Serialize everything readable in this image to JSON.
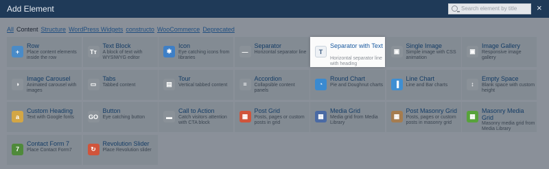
{
  "header": {
    "title": "Add Element",
    "search_placeholder": "Search element by title",
    "close_glyph": "×"
  },
  "tabs": [
    "All",
    "Content",
    "Structure",
    "WordPress Widgets",
    "constructo",
    "WooCommerce",
    "Deprecated"
  ],
  "tiles": [
    {
      "name": "Row",
      "desc": "Place content elements inside the row",
      "icon": "row-icon",
      "glyph": "+",
      "color": "#4a8bc7"
    },
    {
      "name": "Text Block",
      "desc": "A block of text with WYSIWYG editor",
      "icon": "text-block-icon",
      "glyph": "Tт",
      "color": "#8a9198"
    },
    {
      "name": "Icon",
      "desc": "Eye catching icons from libraries",
      "icon": "icon-element-icon",
      "glyph": "✱",
      "color": "#3e7fc6"
    },
    {
      "name": "Separator",
      "desc": "Horizontal separator line",
      "icon": "separator-icon",
      "glyph": "—",
      "color": "#8a9198"
    },
    {
      "name": "Separator with Text",
      "desc": "Horizontal separator line with heading",
      "icon": "separator-with-text-icon",
      "glyph": "T",
      "color": "#eef1f5"
    },
    {
      "name": "Single Image",
      "desc": "Simple image with CSS animation",
      "icon": "single-image-icon",
      "glyph": "▣",
      "color": "#8a9198"
    },
    {
      "name": "Image Gallery",
      "desc": "Responsive image gallery",
      "icon": "image-gallery-icon",
      "glyph": "▣",
      "color": "#8a9198"
    },
    {
      "name": "Image Carousel",
      "desc": "Animated carousel with images",
      "icon": "image-carousel-icon",
      "glyph": "◑",
      "color": "#8a9198"
    },
    {
      "name": "Tabs",
      "desc": "Tabbed content",
      "icon": "tabs-icon",
      "glyph": "▭",
      "color": "#8a9198"
    },
    {
      "name": "Tour",
      "desc": "Vertical tabbed content",
      "icon": "tour-icon",
      "glyph": "▤",
      "color": "#8a9198"
    },
    {
      "name": "Accordion",
      "desc": "Collapsible content panels",
      "icon": "accordion-icon",
      "glyph": "≡",
      "color": "#8a9198"
    },
    {
      "name": "Round Chart",
      "desc": "Pie and Doughnut charts",
      "icon": "round-chart-icon",
      "glyph": "◔",
      "color": "#3a8ad0"
    },
    {
      "name": "Line Chart",
      "desc": "Line and Bar charts",
      "icon": "line-chart-icon",
      "glyph": "▐",
      "color": "#3f8fd2"
    },
    {
      "name": "Empty Space",
      "desc": "Blank space with custom height",
      "icon": "empty-space-icon",
      "glyph": "↕",
      "color": "#8a9198"
    },
    {
      "name": "Custom Heading",
      "desc": "Text with Google fonts",
      "icon": "custom-heading-icon",
      "glyph": "a",
      "color": "#d3a645"
    },
    {
      "name": "Button",
      "desc": "Eye catching button",
      "icon": "button-icon",
      "glyph": "GO",
      "color": "#8a9198"
    },
    {
      "name": "Call to Action",
      "desc": "Catch visitors attention with CTA block",
      "icon": "call-to-action-icon",
      "glyph": "▬",
      "color": "#8a9198"
    },
    {
      "name": "Post Grid",
      "desc": "Posts, pages or custom posts in grid",
      "icon": "post-grid-icon",
      "glyph": "▦",
      "color": "#d0543b"
    },
    {
      "name": "Media Grid",
      "desc": "Media grid from Media Library",
      "icon": "media-grid-icon",
      "glyph": "▦",
      "color": "#4a6aa4"
    },
    {
      "name": "Post Masonry Grid",
      "desc": "Posts, pages or custom posts in masonry grid",
      "icon": "post-masonry-grid-icon",
      "glyph": "▦",
      "color": "#a57c4f"
    },
    {
      "name": "Masonry Media Grid",
      "desc": "Masonry media grid from Media Library",
      "icon": "masonry-media-grid-icon",
      "glyph": "▦",
      "color": "#57a33a"
    },
    {
      "name": "Contact Form 7",
      "desc": "Place Contact Form7",
      "icon": "contact-form-7-icon",
      "glyph": "7",
      "color": "#4f8a3a"
    },
    {
      "name": "Revolution Slider",
      "desc": "Place Revolution slider",
      "icon": "revolution-slider-icon",
      "glyph": "↻",
      "color": "#d0543b"
    }
  ]
}
